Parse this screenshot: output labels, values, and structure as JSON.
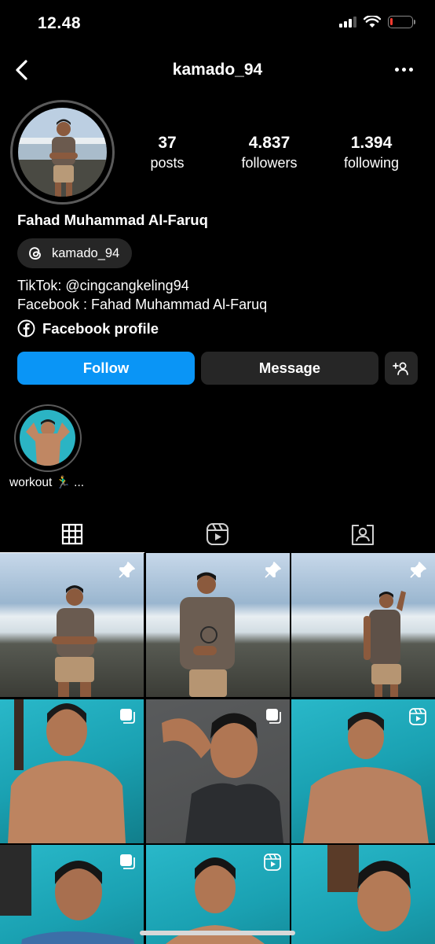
{
  "status_bar": {
    "time": "12.48",
    "battery_level": 0.12,
    "battery_color": "#ff3b30"
  },
  "header": {
    "username": "kamado_94"
  },
  "profile": {
    "posts_count": "37",
    "posts_label": "posts",
    "followers_count": "4.837",
    "followers_label": "followers",
    "following_count": "1.394",
    "following_label": "following",
    "full_name": "Fahad Muhammad Al-Faruq",
    "threads_handle": "kamado_94",
    "bio_line1": "TikTok: @cingcangkeling94",
    "bio_line2": "Facebook : Fahad Muhammad Al-Faruq",
    "link_label": "Facebook profile"
  },
  "actions": {
    "follow_label": "Follow",
    "message_label": "Message",
    "follow_color": "#0a95f6"
  },
  "highlights": [
    {
      "label": "workout 🏃‍♂️ ..."
    }
  ],
  "tabs": [
    {
      "name": "posts-grid",
      "icon": "grid-icon",
      "active": true
    },
    {
      "name": "reels",
      "icon": "reels-icon",
      "active": false
    },
    {
      "name": "tagged",
      "icon": "tagged-person-icon",
      "active": false
    }
  ],
  "grid": [
    {
      "scene": "beach",
      "badge": "pin-icon"
    },
    {
      "scene": "beach",
      "badge": "pin-icon"
    },
    {
      "scene": "beach",
      "badge": "pin-icon"
    },
    {
      "scene": "teal",
      "badge": "carousel-icon"
    },
    {
      "scene": "dark",
      "badge": "carousel-icon"
    },
    {
      "scene": "teal",
      "badge": "reel-icon"
    },
    {
      "scene": "teal",
      "badge": "carousel-icon"
    },
    {
      "scene": "teal",
      "badge": "reel-icon"
    },
    {
      "scene": "teal",
      "badge": ""
    }
  ]
}
